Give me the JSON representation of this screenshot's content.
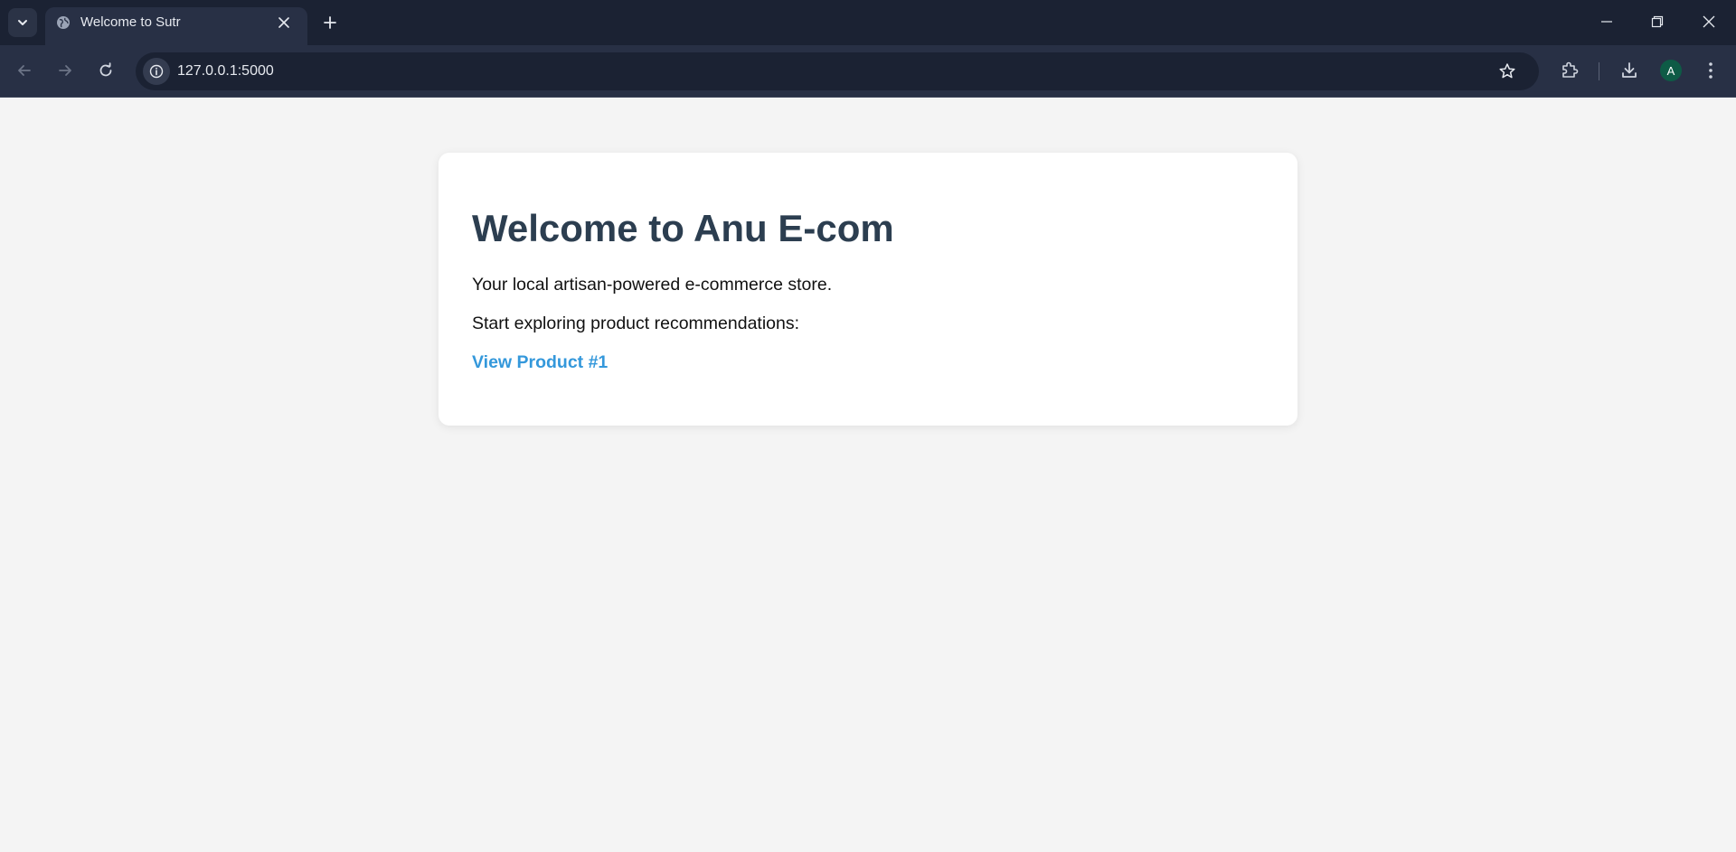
{
  "browser": {
    "tab": {
      "title": "Welcome to Sutr"
    },
    "address_bar": {
      "url": "127.0.0.1:5000"
    },
    "profile": {
      "initial": "A",
      "color": "#0e5b46"
    },
    "icons": {
      "tab_search": "chevron-down-icon",
      "favicon": "globe-icon",
      "tab_close": "close-icon",
      "new_tab": "plus-icon",
      "back": "arrow-left-icon",
      "forward": "arrow-right-icon",
      "reload": "reload-icon",
      "site_info": "info-icon",
      "bookmark": "star-icon",
      "extensions": "puzzle-icon",
      "downloads": "download-icon",
      "menu": "kebab-menu-icon",
      "minimize": "minimize-icon",
      "maximize": "restore-icon",
      "close_window": "close-icon"
    }
  },
  "page": {
    "heading": "Welcome to Anu E-com",
    "tagline": "Your local artisan-powered e-commerce store.",
    "prompt": "Start exploring product recommendations:",
    "link_label": "View Product #1",
    "colors": {
      "heading": "#2c3e50",
      "link": "#3498db",
      "background": "#f4f4f4",
      "card": "#ffffff"
    }
  }
}
